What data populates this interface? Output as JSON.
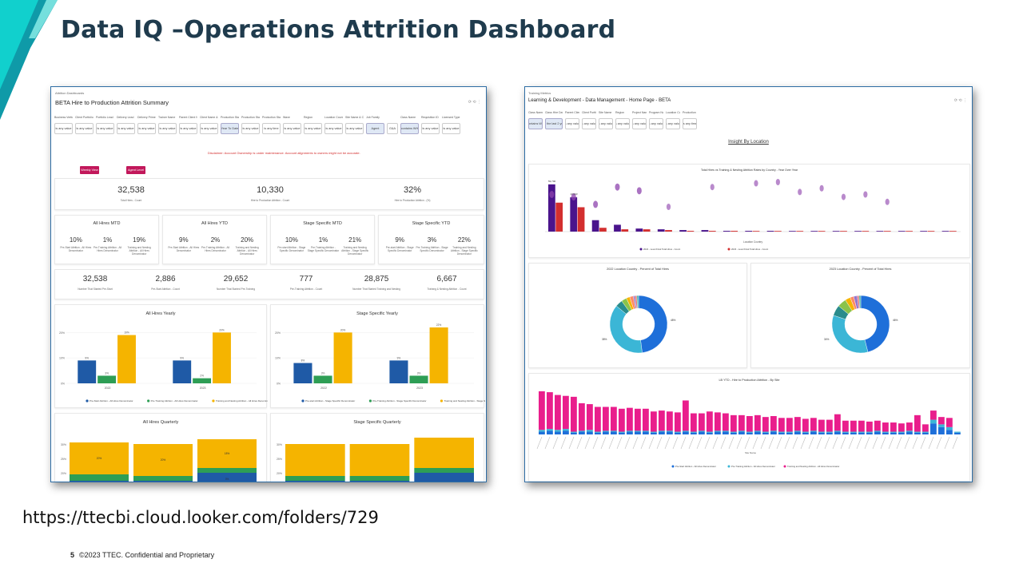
{
  "slide": {
    "title": "Data IQ –Operations Attrition Dashboard",
    "url": "https://ttecbi.cloud.looker.com/folders/729",
    "page_number": "5",
    "footer": "©2023 TTEC. Confidential and Proprietary"
  },
  "colors": {
    "accent_cyan": "#12d6d0",
    "accent_teal": "#0f9aa8",
    "title": "#1f3b4d",
    "series_blue": "#1f5aa6",
    "series_green": "#2e9e55",
    "series_gold": "#f5b400",
    "magenta": "#c2185b"
  },
  "left": {
    "breadcrumb": "Attrition Dashboards",
    "title": "BETA Hire to Production Attrition Summary",
    "filters": [
      {
        "label": "Business Vertical",
        "value": "is any value"
      },
      {
        "label": "Client Portfolio Level 1",
        "value": "is any value"
      },
      {
        "label": "Portfolio Lead",
        "value": "is any value"
      },
      {
        "label": "Delivery Lead",
        "value": "is any value"
      },
      {
        "label": "Delivery Prime",
        "value": "is any value"
      },
      {
        "label": "Trainer Name",
        "value": "is any value"
      },
      {
        "label": "Parent Client Name & Code",
        "value": "is any value"
      },
      {
        "label": "Client Name & Code",
        "value": "is any value"
      },
      {
        "label": "Production Start Date",
        "value": "Year To Date",
        "selected": true
      },
      {
        "label": "Production Start Month",
        "value": "is any value"
      },
      {
        "label": "Production Start Week",
        "value": "is any time"
      },
      {
        "label": "Wave",
        "value": "is any value"
      },
      {
        "label": "Region",
        "value": "is any value"
      },
      {
        "label": "Location Country",
        "value": "is any value"
      },
      {
        "label": "Site Name & Code",
        "value": "is any value"
      },
      {
        "label": "Job Family",
        "value": "Agent",
        "selected": true
      },
      {
        "label": "",
        "value": "G&A"
      },
      {
        "label": "Class Name",
        "value": "contains WH",
        "selected": true
      },
      {
        "label": "Requisition ID",
        "value": "is any value"
      },
      {
        "label": "Licensed Type",
        "value": "is any value"
      }
    ],
    "disclaimer": "Disclaimer: Account Ownership is under maintenance. Account alignments to owners might not be accurate.",
    "buttons": [
      "Weekly View",
      "Agent Level"
    ],
    "kpis": [
      {
        "value": "32,538",
        "label": "Total Hires - Count"
      },
      {
        "value": "10,330",
        "label": "Hire to Production Attrition - Count"
      },
      {
        "value": "32%",
        "label": "Hire to Production Attrition - (%)"
      }
    ],
    "mtd_panels": [
      {
        "title": "All Hires MTD",
        "items": [
          {
            "value": "10%",
            "label": "Pre-Start Attrition - All Hires Denominator"
          },
          {
            "value": "1%",
            "label": "Pre-Training Attrition - All Hires Denominator"
          },
          {
            "value": "19%",
            "label": "Training and Nesting Attrition - All Hires Denominator"
          }
        ]
      },
      {
        "title": "All Hires YTD",
        "items": [
          {
            "value": "9%",
            "label": "Pre-Start Attrition - All Hires Denominator"
          },
          {
            "value": "2%",
            "label": "Pre-Training Attrition - All Hires Denominator"
          },
          {
            "value": "20%",
            "label": "Training and Nesting Attrition - All Hires Denominator"
          }
        ]
      },
      {
        "title": "Stage Specific MTD",
        "items": [
          {
            "value": "10%",
            "label": "Pre-start Attrition - Stage Specific Denominator"
          },
          {
            "value": "1%",
            "label": "Pre-Training Attrition - Stage Specific Denominator"
          },
          {
            "value": "21%",
            "label": "Training and Nesting Attrition - Stage Specific Denominator"
          }
        ]
      },
      {
        "title": "Stage Specific YTD",
        "items": [
          {
            "value": "9%",
            "label": "Pre-start Attrition - Stage Specific Denominator"
          },
          {
            "value": "3%",
            "label": "Pre-Training Attrition - Stage Specific Denominator"
          },
          {
            "value": "22%",
            "label": "Training and Nesting Attrition - Stage Specific Denominator"
          }
        ]
      }
    ],
    "counts": [
      {
        "value": "32,538",
        "label": "Number That Started Pre-Start"
      },
      {
        "value": "2,886",
        "label": "Pre-Start Attrition - Count"
      },
      {
        "value": "29,652",
        "label": "Number That Started Pre-Training"
      },
      {
        "value": "777",
        "label": "Pre-Training Attrition - Count"
      },
      {
        "value": "28,875",
        "label": "Number That Started Training and Nesting"
      },
      {
        "value": "6,667",
        "label": "Training & Nesting Attrition - Count"
      }
    ],
    "quarterly_titles": [
      "All Hires Quarterly",
      "Stage Specific Quarterly"
    ]
  },
  "right": {
    "breadcrumb": "Training Metrics",
    "title": "Learning & Development - Data Management - Home Page - BETA",
    "filters": [
      {
        "label": "Class Name",
        "value": "contains WH",
        "selected": true
      },
      {
        "label": "Class Hire Date",
        "value": "is in the last 2 years",
        "selected": true
      },
      {
        "label": "Parent Client Name",
        "value": "is any value"
      },
      {
        "label": "Client Portfolio",
        "value": "is any value"
      },
      {
        "label": "Site Name",
        "value": "is any value"
      },
      {
        "label": "Region",
        "value": "is any value"
      },
      {
        "label": "Project Name",
        "value": "is any value"
      },
      {
        "label": "Program Name",
        "value": "is any value"
      },
      {
        "label": "Location Country",
        "value": "is any value"
      },
      {
        "label": "Production Start Date",
        "value": "is any time"
      }
    ],
    "section_title": "Insight By Location",
    "donut_titles": [
      "2022 Location Country - Percent of Total Hires",
      "2023 Location Country - Percent of Total Hires"
    ],
    "donut_labels": [
      {
        "big": "48%",
        "small": "38%"
      },
      {
        "big": "46%",
        "small": "34%"
      }
    ],
    "location_country_axis": "Location Country",
    "site_axis": "Site Name"
  },
  "chart_data": [
    {
      "type": "bar",
      "title": "All Hires Yearly",
      "categories": [
        "2022",
        "2023"
      ],
      "series": [
        {
          "name": "Pre-Start Attrition - All Hires Denominator",
          "values": [
            9,
            9
          ]
        },
        {
          "name": "Pre-Training Attrition - All Hires Denominator",
          "values": [
            3,
            2
          ]
        },
        {
          "name": "Training and Nesting Attrition - All Hires Denominator",
          "values": [
            19,
            20
          ]
        }
      ],
      "ylim": [
        0,
        20
      ],
      "ytick_labels": [
        "0%",
        "10%",
        "20%"
      ],
      "value_labels": [
        [
          "9%",
          "3%",
          "19%"
        ],
        [
          "9%",
          "2%",
          "20%"
        ]
      ]
    },
    {
      "type": "bar",
      "title": "Stage Specific Yearly",
      "categories": [
        "2022",
        "2023"
      ],
      "series": [
        {
          "name": "Pre-start Attrition - Stage Specific Denominator",
          "values": [
            8,
            9
          ]
        },
        {
          "name": "Pre-Training Attrition - Stage Specific Denominator",
          "values": [
            3,
            3
          ]
        },
        {
          "name": "Training and Nesting Attrition - Stage Specific Denominator",
          "values": [
            20,
            22
          ]
        }
      ],
      "ylim": [
        0,
        20
      ],
      "ytick_labels": [
        "0%",
        "10%",
        "20%"
      ],
      "value_labels": [
        [
          "8%",
          "3%",
          "20%"
        ],
        [
          "9%",
          "3%",
          "22%"
        ]
      ]
    },
    {
      "type": "bar",
      "title": "All Hires Quarterly",
      "stacked": true,
      "series": [
        {
          "values": [
            3,
            3,
            8
          ]
        },
        {
          "values": [
            4,
            3,
            3
          ]
        },
        {
          "values": [
            20,
            20,
            18
          ]
        }
      ],
      "ytick_labels": [
        "20%",
        "25%",
        "30%"
      ],
      "value_labels": [
        [
          "3%",
          "20%"
        ],
        [
          "3%",
          "20%"
        ],
        [
          "3%",
          "18%"
        ]
      ]
    },
    {
      "type": "bar",
      "title": "Stage Specific Quarterly",
      "stacked": true,
      "series": [
        {
          "values": [
            3,
            3,
            8
          ]
        },
        {
          "values": [
            3,
            3,
            3
          ]
        },
        {
          "values": [
            20,
            20,
            19
          ]
        }
      ],
      "ytick_labels": [
        "20%",
        "25%",
        "30%"
      ]
    },
    {
      "type": "bar",
      "title": "Total Hires vs Training & Nesting Attrition Rates by Country - Year Over Year",
      "xlabel": "Location Country",
      "series": [
        {
          "name": "2022 - Level Final Total Hires - Count",
          "values": [
            62,
            45,
            15,
            9,
            4,
            3,
            2,
            2,
            1,
            1,
            1,
            0.5,
            0.5,
            0.5,
            0.5,
            0.5,
            0.3,
            0.3,
            0.3
          ]
        },
        {
          "name": "2023 - Level Final Total Hires - Count",
          "values": [
            38,
            32,
            5,
            3,
            3,
            2,
            1,
            1,
            1,
            0.5,
            0.5,
            0.5,
            0.5,
            0.5,
            0.3,
            0.3,
            0.3,
            0.3,
            0.3
          ]
        }
      ],
      "value_labels": [
        "59,796",
        "13,593"
      ],
      "bubbles_2022_pct": [
        30,
        28,
        22,
        36,
        33,
        0,
        0,
        0,
        0,
        0,
        0,
        0,
        0,
        0,
        0,
        0,
        0,
        0,
        0
      ],
      "bubbles_2023_pct": [
        0,
        0,
        0,
        0,
        0,
        20,
        0,
        36,
        0,
        39,
        40,
        32,
        35,
        28,
        30,
        24,
        0,
        0,
        0
      ]
    },
    {
      "type": "pie",
      "title": "2022 Location Country - Percent of Total Hires",
      "values": [
        48,
        38,
        4,
        3,
        2,
        2,
        1,
        1,
        1
      ],
      "labels": [
        "48%",
        "38%"
      ]
    },
    {
      "type": "pie",
      "title": "2023 Location Country - Percent of Total Hires",
      "values": [
        46,
        34,
        6,
        5,
        3,
        2,
        2,
        1,
        1
      ],
      "labels": [
        "46%",
        "34%"
      ]
    },
    {
      "type": "bar",
      "title": "LB YTD - Hire to Production Attrition - By Site",
      "stacked": true,
      "xlabel": "Site Name",
      "series": [
        {
          "name": "Pre-Start Attrition - All Hires Denominator",
          "values": [
            3,
            4,
            3,
            4,
            2,
            3,
            3,
            2,
            3,
            3,
            2,
            3,
            3,
            3,
            2,
            3,
            3,
            2,
            3,
            2,
            3,
            2,
            3,
            3,
            2,
            3,
            2,
            3,
            2,
            3,
            2,
            2,
            3,
            2,
            3,
            2,
            2,
            3,
            2,
            2,
            2,
            2,
            3,
            2,
            2,
            2,
            3,
            2,
            2,
            12,
            8,
            5,
            2
          ]
        },
        {
          "name": "Pre-Training Attrition - All Hires Denominator",
          "values": [
            2,
            2,
            2,
            2,
            1,
            1,
            2,
            1,
            1,
            1,
            1,
            1,
            1,
            1,
            1,
            1,
            1,
            1,
            1,
            1,
            1,
            1,
            1,
            1,
            1,
            1,
            1,
            1,
            1,
            1,
            1,
            1,
            1,
            1,
            1,
            1,
            1,
            1,
            1,
            1,
            1,
            1,
            1,
            1,
            1,
            1,
            1,
            1,
            1,
            4,
            3,
            3,
            1
          ]
        },
        {
          "name": "Training and Nesting Attrition - All Hires Denominator",
          "values": [
            42,
            40,
            38,
            36,
            38,
            30,
            28,
            27,
            26,
            26,
            25,
            25,
            24,
            24,
            22,
            22,
            21,
            21,
            33,
            20,
            19,
            22,
            20,
            19,
            18,
            17,
            17,
            17,
            16,
            16,
            15,
            15,
            15,
            14,
            14,
            13,
            13,
            18,
            12,
            12,
            12,
            11,
            11,
            10,
            10,
            9,
            9,
            18,
            8,
            10,
            8,
            10,
            0
          ]
        }
      ]
    }
  ]
}
